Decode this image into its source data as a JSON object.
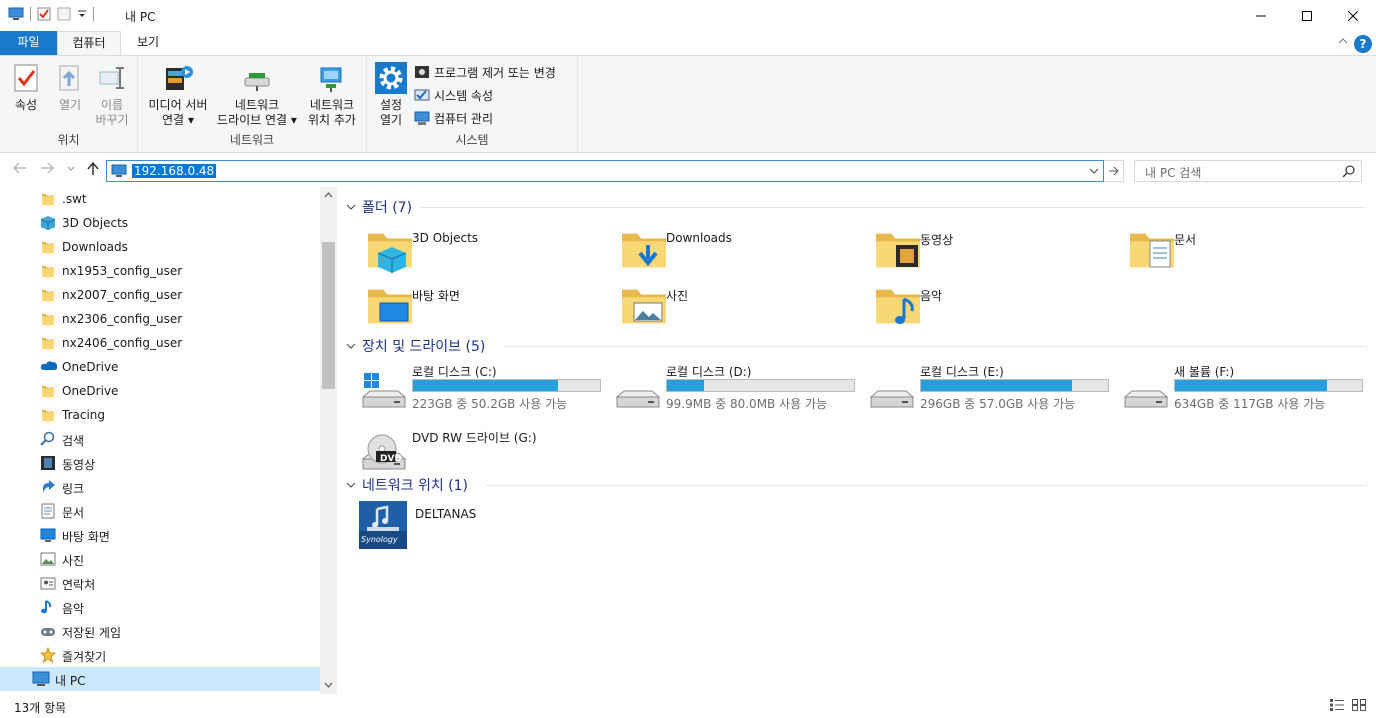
{
  "window": {
    "title": "내 PC",
    "minimize_glyph": "—",
    "maximize_glyph": "☐",
    "close_glyph": "✕"
  },
  "ribbon_tabs": {
    "file": "파일",
    "computer": "컴퓨터",
    "view": "보기",
    "help": "?"
  },
  "ribbon": {
    "location_group": "위치",
    "properties": "속성",
    "open": "열기",
    "rename_l1": "이름",
    "rename_l2": "바꾸기",
    "network_group": "네트워크",
    "media_l1": "미디어 서버",
    "media_l2": "연결",
    "map_drive_l1": "네트워크",
    "map_drive_l2": "드라이브 연결",
    "add_location_l1": "네트워크",
    "add_location_l2": "위치 추가",
    "system_group": "시스템",
    "settings_l1": "설정",
    "settings_l2": "열기",
    "uninstall": "프로그램 제거 또는 변경",
    "sys_props": "시스템 속성",
    "manage": "컴퓨터 관리"
  },
  "address": {
    "value": "192.168.0.48",
    "search_placeholder": "내 PC 검색"
  },
  "tree": [
    {
      "label": ".swt",
      "icon": "folder-icon"
    },
    {
      "label": "3D Objects",
      "icon": "3d-objects-icon"
    },
    {
      "label": "Downloads",
      "icon": "folder-icon"
    },
    {
      "label": "nx1953_config_user",
      "icon": "folder-icon"
    },
    {
      "label": "nx2007_config_user",
      "icon": "folder-icon"
    },
    {
      "label": "nx2306_config_user",
      "icon": "folder-icon"
    },
    {
      "label": "nx2406_config_user",
      "icon": "folder-icon"
    },
    {
      "label": "OneDrive",
      "icon": "onedrive-icon"
    },
    {
      "label": "OneDrive",
      "icon": "folder-icon"
    },
    {
      "label": "Tracing",
      "icon": "folder-icon"
    },
    {
      "label": "검색",
      "icon": "search-icon"
    },
    {
      "label": "동영상",
      "icon": "video-icon"
    },
    {
      "label": "링크",
      "icon": "link-icon"
    },
    {
      "label": "문서",
      "icon": "document-icon"
    },
    {
      "label": "바탕 화면",
      "icon": "desktop-icon"
    },
    {
      "label": "사진",
      "icon": "picture-icon"
    },
    {
      "label": "연락처",
      "icon": "contacts-icon"
    },
    {
      "label": "음악",
      "icon": "music-icon"
    },
    {
      "label": "저장된 게임",
      "icon": "games-icon"
    },
    {
      "label": "즐겨찾기",
      "icon": "favorites-icon"
    },
    {
      "label": "내 PC",
      "icon": "this-pc-icon",
      "selected": true
    }
  ],
  "sections": {
    "folders": "폴더 (7)",
    "drives": "장치 및 드라이브 (5)",
    "network": "네트워크 위치 (1)"
  },
  "folders": [
    {
      "label": "3D Objects",
      "icon": "3d-objects-folder-icon"
    },
    {
      "label": "Downloads",
      "icon": "downloads-folder-icon"
    },
    {
      "label": "동영상",
      "icon": "videos-folder-icon"
    },
    {
      "label": "문서",
      "icon": "documents-folder-icon"
    },
    {
      "label": "바탕 화면",
      "icon": "desktop-folder-icon"
    },
    {
      "label": "사진",
      "icon": "pictures-folder-icon"
    },
    {
      "label": "음악",
      "icon": "music-folder-icon"
    }
  ],
  "drives": [
    {
      "name": "로컬 디스크 (C:)",
      "free": "223GB 중 50.2GB 사용 가능",
      "used_fraction": 0.775,
      "icon": "windows-drive-icon"
    },
    {
      "name": "로컬 디스크 (D:)",
      "free": "99.9MB 중 80.0MB 사용 가능",
      "used_fraction": 0.2,
      "icon": "hard-drive-icon"
    },
    {
      "name": "로컬 디스크 (E:)",
      "free": "296GB 중 57.0GB 사용 가능",
      "used_fraction": 0.81,
      "icon": "hard-drive-icon"
    },
    {
      "name": "새 볼륨 (F:)",
      "free": "634GB 중 117GB 사용 가능",
      "used_fraction": 0.815,
      "icon": "hard-drive-icon"
    },
    {
      "name": "DVD RW 드라이브 (G:)",
      "icon": "dvd-drive-icon",
      "badge": "DVD"
    }
  ],
  "network_locations": [
    {
      "label": "DELTANAS",
      "icon": "synology-nas-icon",
      "brand": "Synology"
    }
  ],
  "status": {
    "count": "13개 항목"
  },
  "colors": {
    "accent": "#1979ca",
    "bar_fill": "#26a0da",
    "selection": "#cce8ff",
    "section_text": "#1e3287"
  }
}
